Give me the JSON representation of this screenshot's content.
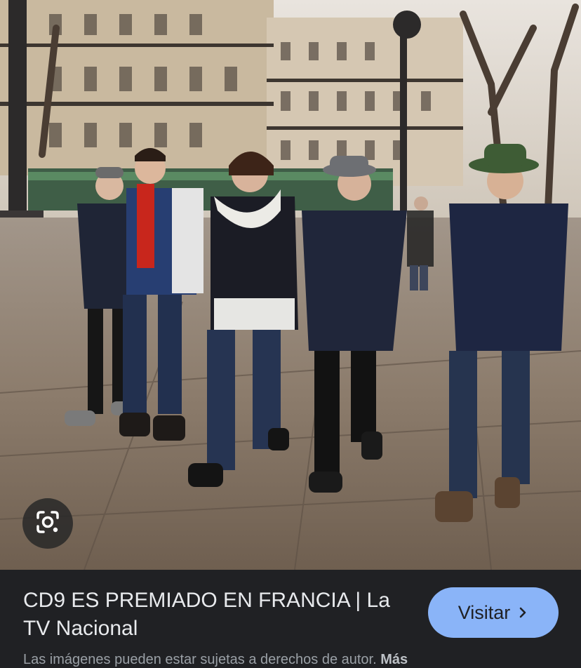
{
  "image_card": {
    "photo_alt": "Five young men walking on a wet Paris sidewalk",
    "caption_title": "CD9 ES PREMIADO EN FRANCIA | La TV Nacional",
    "visit_label": "Visitar",
    "notice_text": "Las imágenes pueden estar sujetas a derechos de autor.",
    "notice_more": "Más"
  },
  "icons": {
    "lens": "google-lens-icon",
    "chevron": "chevron-right-icon"
  },
  "colors": {
    "panel_bg": "#202124",
    "title_text": "#e8eaed",
    "button_bg": "#8ab4f8",
    "button_text": "#202124",
    "notice_text": "#9aa0a6"
  }
}
